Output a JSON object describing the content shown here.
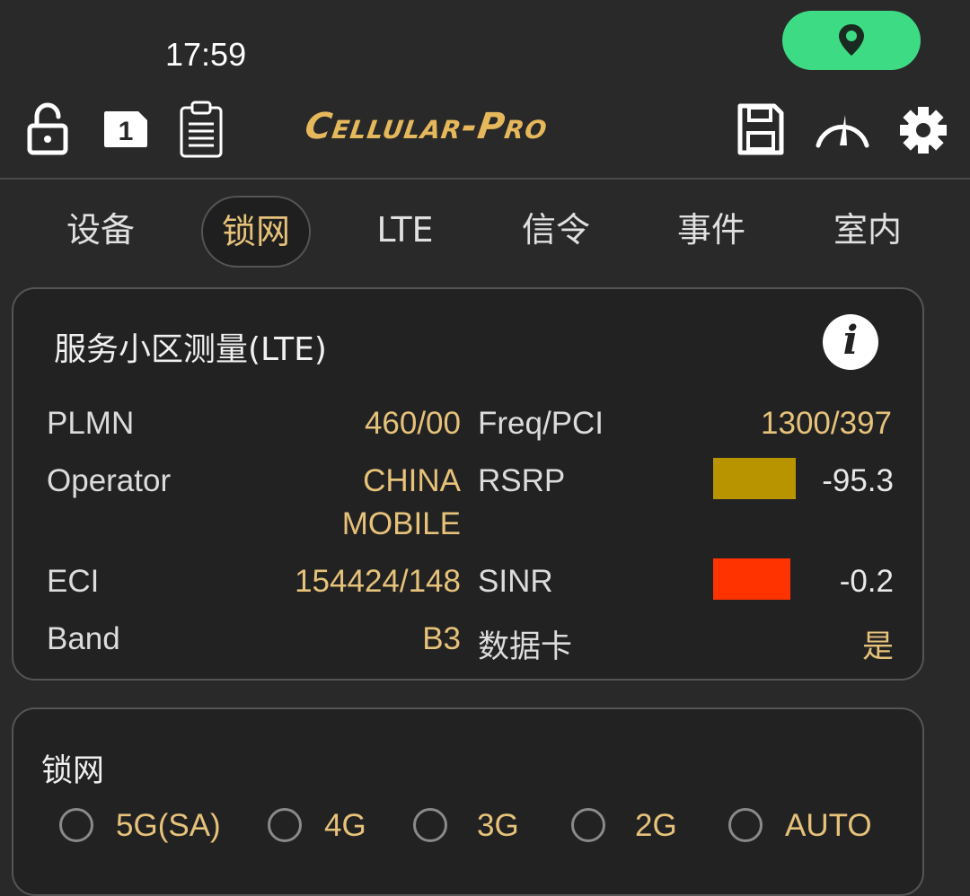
{
  "status_bar": {
    "time": "17:59",
    "location_pill_color": "#3ddc84"
  },
  "toolbar": {
    "app_title": "Cellular-Pro",
    "sim_slot": "1",
    "icons": [
      "lock-open-icon",
      "sim-card-icon",
      "clipboard-icon",
      "save-icon",
      "speedometer-icon",
      "gear-icon"
    ]
  },
  "tabs": [
    {
      "label": "设备",
      "active": false
    },
    {
      "label": "锁网",
      "active": true
    },
    {
      "label": "LTE",
      "active": false
    },
    {
      "label": "信令",
      "active": false
    },
    {
      "label": "事件",
      "active": false
    },
    {
      "label": "室内",
      "active": false
    }
  ],
  "serving_cell": {
    "title": "服务小区测量(LTE)",
    "left": [
      {
        "label": "PLMN",
        "value": "460/00"
      },
      {
        "label": "Operator",
        "value_line1": "CHINA",
        "value_line2": "MOBILE"
      },
      {
        "label": "ECI",
        "value": "154424/148"
      },
      {
        "label": "Band",
        "value": "B3"
      }
    ],
    "right": [
      {
        "label": "Freq/PCI",
        "value": "1300/397"
      },
      {
        "label": "RSRP",
        "value": "-95.3",
        "swatch_color": "#b89400"
      },
      {
        "label": "SINR",
        "value": "-0.2",
        "swatch_color": "#ff3300"
      },
      {
        "label": "数据卡",
        "value": "是"
      }
    ]
  },
  "lock_network": {
    "title": "锁网",
    "options": [
      "5G(SA)",
      "4G",
      "3G",
      "2G",
      "AUTO"
    ]
  },
  "colors": {
    "accent": "#e6c27a",
    "background": "#292929",
    "card": "#222222"
  }
}
